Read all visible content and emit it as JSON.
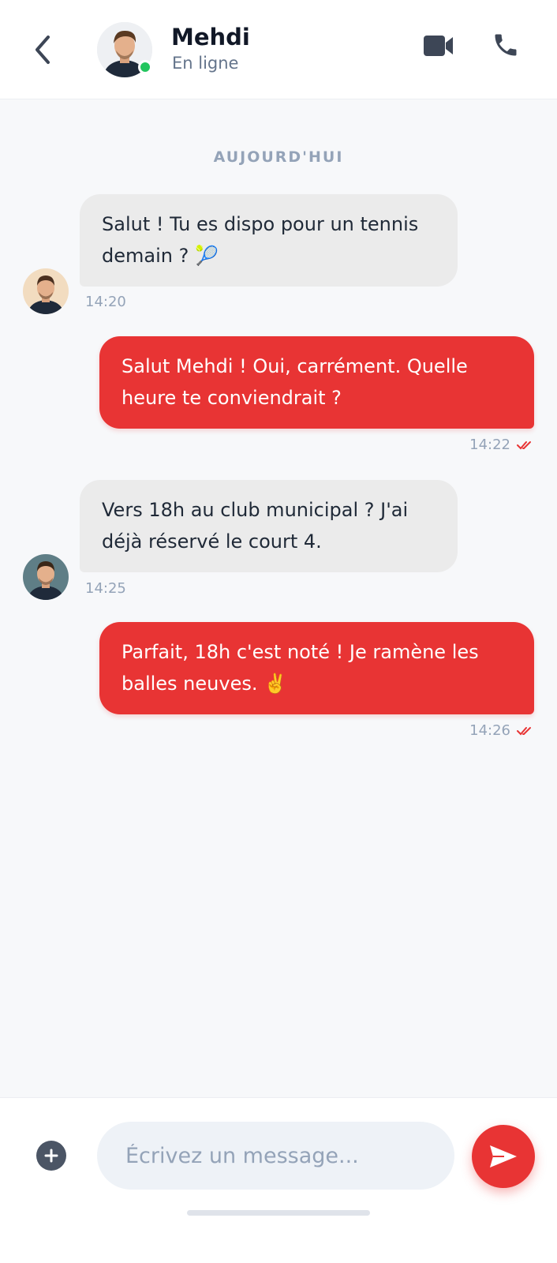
{
  "header": {
    "name": "Mehdi",
    "status": "En ligne",
    "icons": {
      "back": "chevron-left-icon",
      "video": "video-camera-icon",
      "call": "phone-icon"
    },
    "online_color": "#22c55e"
  },
  "date_separator": "AUJOURD'HUI",
  "messages": [
    {
      "direction": "in",
      "text": "Salut ! Tu es dispo pour un tennis demain ? 🎾",
      "time": "14:20"
    },
    {
      "direction": "out",
      "text": "Salut Mehdi ! Oui, carrément. Quelle heure te conviendrait ?",
      "time": "14:22",
      "read": true
    },
    {
      "direction": "in",
      "text": "Vers 18h au club municipal ? J'ai déjà réservé le court 4.",
      "time": "14:25"
    },
    {
      "direction": "out",
      "text": "Parfait, 18h c'est noté ! Je ramène les balles neuves. ✌️",
      "time": "14:26",
      "read": true
    }
  ],
  "composer": {
    "placeholder": "Écrivez un message...",
    "value": "",
    "icons": {
      "attach": "plus-circle-icon",
      "send": "send-icon"
    }
  },
  "colors": {
    "accent": "#e83434",
    "incoming_bubble": "#ebebeb",
    "background": "#f7f8fa",
    "muted_text": "#94a3b8"
  }
}
